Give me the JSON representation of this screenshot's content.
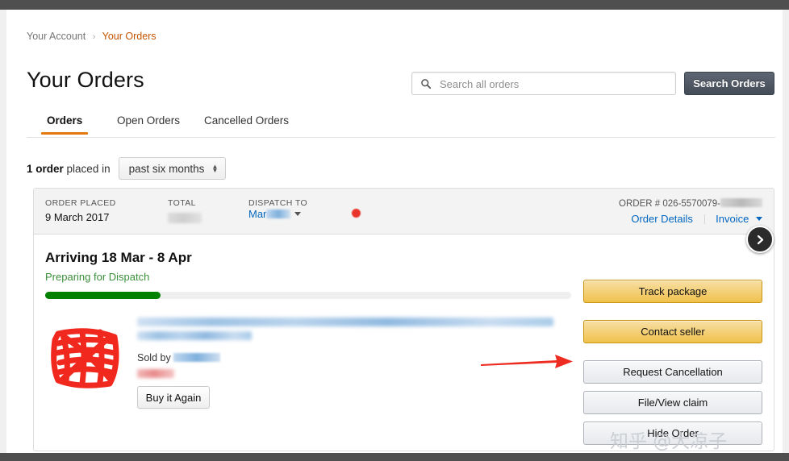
{
  "breadcrumb": {
    "parent": "Your Account",
    "separator": "›",
    "current": "Your Orders"
  },
  "header": {
    "title": "Your Orders"
  },
  "search": {
    "placeholder": "Search all orders",
    "value": "",
    "button_label": "Search Orders",
    "icon": "search-icon"
  },
  "tabs": [
    {
      "label": "Orders",
      "active": true
    },
    {
      "label": "Open Orders",
      "active": false
    },
    {
      "label": "Cancelled Orders",
      "active": false
    }
  ],
  "filter": {
    "count_text": "1 order",
    "placed_in_text": "placed in",
    "period_selected": "past six months",
    "stepper_icon": "updown-arrows-icon"
  },
  "order": {
    "placed_label": "ORDER PLACED",
    "placed_value": "9 March 2017",
    "total_label": "TOTAL",
    "total_value_redacted": true,
    "dispatch_label": "DISPATCH TO",
    "dispatch_value_prefix": "Mar",
    "dispatch_caret_icon": "caret-down-icon",
    "order_number_label": "ORDER #",
    "order_number_value": "026-5570079-",
    "order_details_link": "Order Details",
    "invoice_link": "Invoice",
    "invoice_caret_icon": "caret-down-icon",
    "next_icon": "chevron-right-icon"
  },
  "shipment": {
    "arriving": "Arriving 18 Mar - 8 Apr",
    "status": "Preparing for Dispatch",
    "progress_percent": 22
  },
  "product": {
    "title_redacted": true,
    "sold_by_label": "Sold by",
    "seller_redacted": true,
    "price_redacted": true,
    "buy_again_label": "Buy it Again",
    "image_alt": "redacted-product-image"
  },
  "actions": [
    {
      "label": "Track package",
      "style": "gold"
    },
    {
      "label": "Contact seller",
      "style": "gold"
    },
    {
      "label": "Request Cancellation",
      "style": "grey"
    },
    {
      "label": "File/View claim",
      "style": "grey"
    },
    {
      "label": "Hide Order",
      "style": "grey"
    }
  ],
  "annotations": {
    "arrow_color": "#ee2b20",
    "dot_color": "#e8342a",
    "watermark": "知乎 @大凉子"
  },
  "colors": {
    "accent_orange": "#e47911",
    "link_blue": "#0066c0",
    "green": "#028000",
    "gold_button": "#f0c14b"
  }
}
